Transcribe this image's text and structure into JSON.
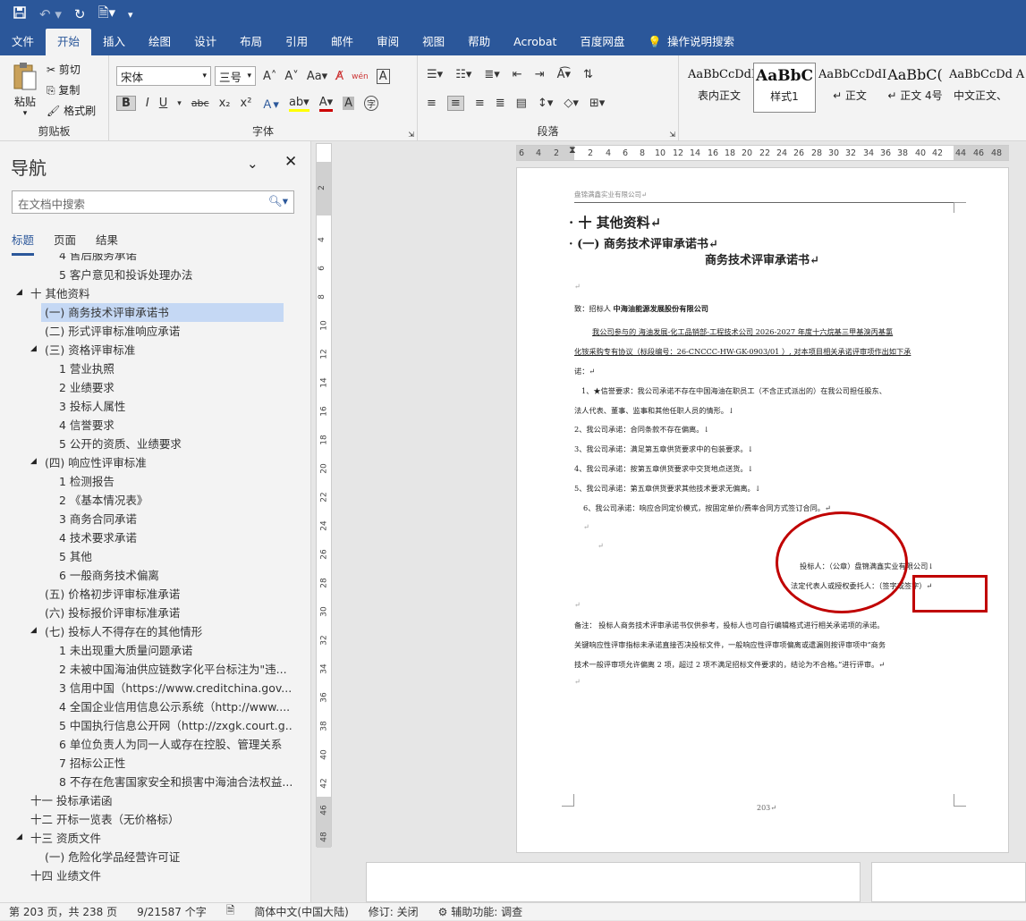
{
  "qat": {
    "icons": [
      "save-icon",
      "undo-icon",
      "redo-icon",
      "document-icon",
      "customize-icon"
    ]
  },
  "tabs": [
    "文件",
    "开始",
    "插入",
    "绘图",
    "设计",
    "布局",
    "引用",
    "邮件",
    "审阅",
    "视图",
    "帮助",
    "Acrobat",
    "百度网盘"
  ],
  "tell_me": "操作说明搜索",
  "clipboard": {
    "paste": "粘贴",
    "cut": "剪切",
    "copy": "复制",
    "format_painter": "格式刷",
    "label": "剪贴板"
  },
  "font": {
    "name": "宋体",
    "size": "三号",
    "label": "字体",
    "aa": "Aa",
    "wen": "wén",
    "a_box": "A",
    "bold": "B",
    "italic": "I",
    "underline": "U",
    "strike": "abc",
    "sub": "x₂",
    "sup": "x²",
    "font_color": "A",
    "shade_a": "A",
    "circle_char": "字"
  },
  "paragraph": {
    "label": "段落"
  },
  "styles": [
    {
      "sample": "AaBbCcDdI",
      "name": "表内正文"
    },
    {
      "sample": "AaBbC",
      "name": "样式1"
    },
    {
      "sample": "AaBbCcDdI",
      "name": "↵ 正文"
    },
    {
      "sample": "AaBbC(",
      "name": "↵ 正文 4号"
    },
    {
      "sample": "AaBbCcDd",
      "name": "中文正文、"
    },
    {
      "sample": "A",
      "name": ""
    }
  ],
  "nav": {
    "title": "导航",
    "search_placeholder": "在文档中搜索",
    "tabs": [
      "标题",
      "页面",
      "结果"
    ],
    "items": [
      "4 售后服务承诺",
      "5 客户意见和投诉处理办法",
      "十 其他资料",
      "(一) 商务技术评审承诺书",
      "(二) 形式评审标准响应承诺",
      "(三) 资格评审标准",
      "1 营业执照",
      "2 业绩要求",
      "3 投标人属性",
      "4 信誉要求",
      "5 公开的资质、业绩要求",
      "(四) 响应性评审标准",
      "1 检测报告",
      "2 《基本情况表》",
      "3 商务合同承诺",
      "4 技术要求承诺",
      "5 其他",
      "6 一般商务技术偏离",
      "(五) 价格初步评审标准承诺",
      "(六) 投标报价评审标准承诺",
      "(七) 投标人不得存在的其他情形",
      "1 未出现重大质量问题承诺",
      "2 未被中国海油供应链数字化平台标注为\"违...",
      "3 信用中国（https://www.creditchina.gov....",
      "4 全国企业信用信息公示系统（http://www....",
      "5 中国执行信息公开网（http://zxgk.court.g...",
      "6 单位负责人为同一人或存在控股、管理关系",
      "7 招标公正性",
      "8 不存在危害国家安全和损害中海油合法权益...",
      "十一 投标承诺函",
      "十二 开标一览表（无价格标）",
      "十三 资质文件",
      "(一) 危险化学品经营许可证",
      "十四 业绩文件"
    ]
  },
  "hruler": [
    "6",
    "4",
    "2",
    "",
    "2",
    "4",
    "6",
    "8",
    "10",
    "12",
    "14",
    "16",
    "18",
    "20",
    "22",
    "24",
    "26",
    "28",
    "30",
    "32",
    "34",
    "36",
    "38",
    "40",
    "42",
    "44",
    "46",
    "48"
  ],
  "vruler": [
    "2",
    "2",
    "4",
    "6",
    "8",
    "10",
    "12",
    "14",
    "16",
    "18",
    "20",
    "22",
    "24",
    "26",
    "28",
    "30",
    "32",
    "34",
    "36",
    "38",
    "40",
    "42",
    "44",
    "46",
    "48"
  ],
  "doc": {
    "header": "盘锦满鑫实业有限公司↵",
    "h1": "十 其他资料↵",
    "h2": "(一)  商务技术评审承诺书↵",
    "title": "商务技术评审承诺书↵",
    "blank": "↵",
    "to_label": "致：招标人 ",
    "to_name": "中海油能源发展股份有限公司",
    "p1a": "我公司参与的 海油发展-化工品销部-工程技术公司 2026-2027 年度十六烷基三甲基溴丙基氯",
    "p1b": "化铵采购专有协议（标段编号：26-CNCCC-HW-GK-0903/01 ）, 对本项目相关承诺评审项作出如下承",
    "p1c": "诺：↵",
    "i1a": "1、★信誉要求：我公司承诺不存在中国海油在职员工（不含正式派出的）在我公司担任股东、",
    "i1b": "法人代表、董事、监事和其他任职人员的情形。↓",
    "i2": "2、我公司承诺：合同条款不存在偏离。↓",
    "i3": "3、我公司承诺：满足第五章供货要求中的包装要求。↓",
    "i4": "4、我公司承诺：按第五章供货要求中交货地点送货。↓",
    "i5": "5、我公司承诺：第五章供货要求其他技术要求无偏离。↓",
    "i6": "6、我公司承诺：响应合同定价模式，按固定单价/费率合同方式签订合同。↵",
    "signer": "投标人：（公章）盘锦满鑫实业有限公司↓",
    "rep": "法定代表人或授权委托人：（签字或签字）↵",
    "note1": "备注：  投标人商务技术评审承诺书仅供参考，投标人也可自行编辑格式进行相关承诺项的承诺。",
    "note2": "关键响应性评审指标未承诺直接否决投标文件，一般响应性评审项偏离或遗漏则按评审项中“商务",
    "note3": "技术一般评审项允许偏离 2 项，超过 2 项不满足招标文件要求的，结论为不合格。”进行评审。↵",
    "page_no": "203↵"
  },
  "status": {
    "page": "第 203 页，共 238 页",
    "words": "9/21587 个字",
    "lang": "简体中文(中国大陆)",
    "revisions": "修订: 关闭",
    "accessibility": "辅助功能: 调查"
  },
  "colors": {
    "brand": "#2b579a",
    "annotation": "#c00000",
    "selection": "#c5d8f4"
  }
}
